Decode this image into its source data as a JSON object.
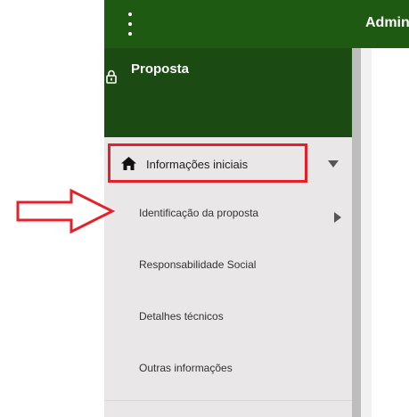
{
  "app": {
    "title": "Admin"
  },
  "header": {
    "title": "Proposta"
  },
  "menu": {
    "section_label": "Informações iniciais",
    "items": [
      {
        "label": "Identificação da proposta"
      },
      {
        "label": "Responsabilidade Social"
      },
      {
        "label": "Detalhes técnicos"
      },
      {
        "label": "Outras informações"
      }
    ]
  },
  "colors": {
    "topbar": "#1f5a12",
    "sidebar_header": "#1b4a12",
    "sidebar": "#e9e7e7",
    "annotation_red": "#e5202a"
  },
  "icons": {
    "menu": "kebab-menu-icon",
    "header": "lock-icon",
    "section": "home-icon",
    "expand": "chevron-down-icon",
    "submenu": "chevron-right-icon",
    "annotation": "outline-arrow-right-icon"
  }
}
